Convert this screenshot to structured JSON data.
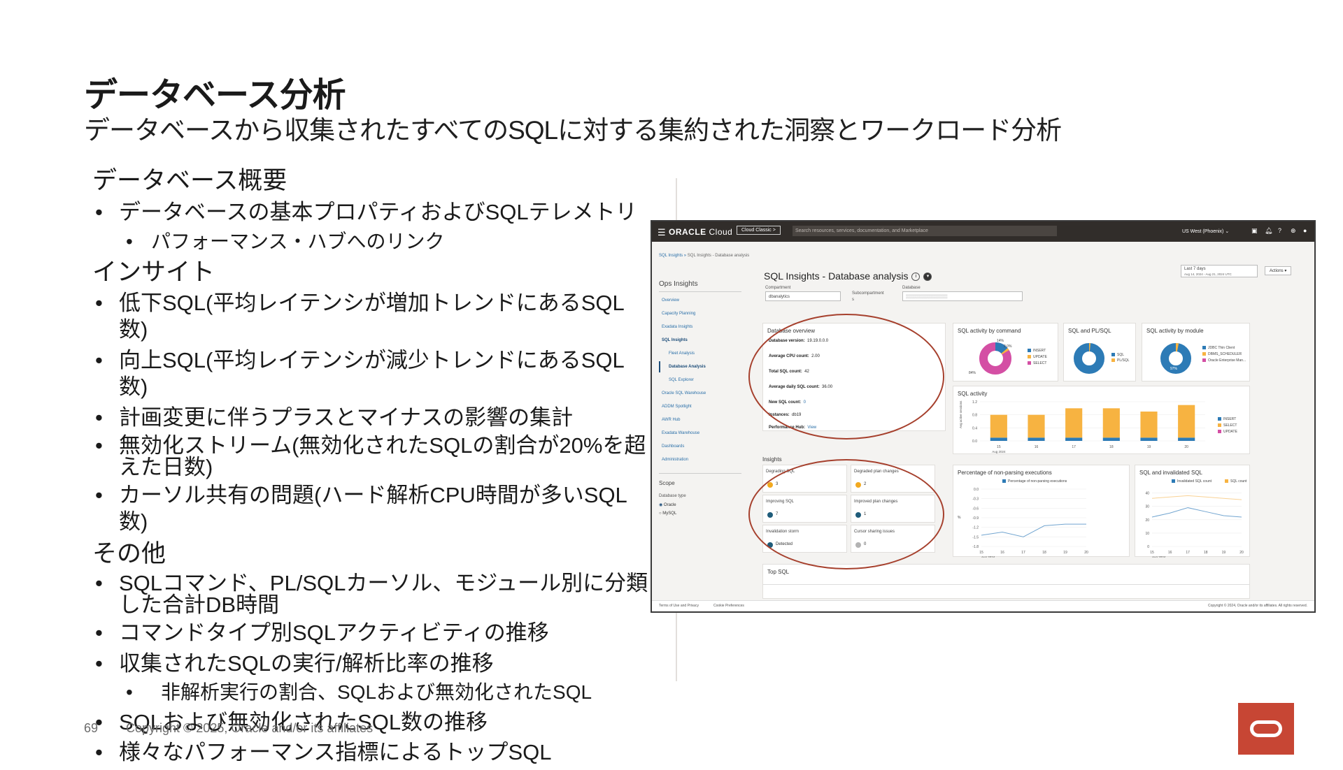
{
  "slide": {
    "title": "データベース分析",
    "subtitle": "データベースから収集されたすべてのSQLに対する集約された洞察とワークロード分析",
    "page_number": "69",
    "copyright": "Copyright © 2025, Oracle and/or its affiliates"
  },
  "outline": {
    "h1": "データベース概要",
    "i1": "データベースの基本プロパティおよびSQLテレメトリ",
    "i1a": "パフォーマンス・ハブへのリンク",
    "h2": "インサイト",
    "i2": "低下SQL(平均レイテンシが増加トレンドにあるSQL数)",
    "i3": "向上SQL(平均レイテンシが減少トレンドにあるSQL数)",
    "i4": "計画変更に伴うプラスとマイナスの影響の集計",
    "i5": "無効化ストリーム(無効化されたSQLの割合が20%を超えた日数)",
    "i6": "カーソル共有の問題(ハード解析CPU時間が多いSQL数)",
    "h3": "その他",
    "i7": "SQLコマンド、PL/SQLカーソル、モジュール別に分類した合計DB時間",
    "i8": "コマンドタイプ別SQLアクティビティの推移",
    "i9": "収集されたSQLの実行/解析比率の推移",
    "i9a": "非解析実行の割合、SQLおよび無効化されたSQL",
    "i10": "SQLおよび無効化されたSQL数の推移",
    "i11": "様々なパフォーマンス指標によるトップSQL"
  },
  "console": {
    "brand_a": "ORACLE",
    "brand_b": " Cloud",
    "classic": "Cloud Classic >",
    "search_placeholder": "Search resources, services, documentation, and Marketplace",
    "region": "US West (Phoenix) ⌄",
    "crumb_a": "SQL Insights »",
    "crumb_b": " SQL Insights - Database analysis",
    "nav_title": "Ops Insights",
    "nav": [
      "Overview",
      "Capacity Planning",
      "Exadata Insights",
      "SQL Insights",
      "Fleet Analysis",
      "Database Analysis",
      "SQL Explorer",
      "Oracle SQL Warehouse",
      "ADDM Spotlight",
      "AWR Hub",
      "Exadata Warehouse",
      "Dashboards",
      "Administration"
    ],
    "scope": "Scope",
    "db_type": "Database type",
    "db_oracle": "Oracle",
    "db_mysql": "MySQL",
    "page_title": "SQL Insights - Database analysis",
    "compartment_label": "Compartment",
    "compartment_value": "dbanalytics",
    "subcompartment_label": "Subcompartment",
    "subcompartment_value": "s",
    "database_label": "Database",
    "time_label": "Last 7 days",
    "time_range": "Aug 14, 2024 - Aug 21, 2024 UTC",
    "actions": "Actions ▾",
    "overview": {
      "title": "Database overview",
      "version_k": "Database version:",
      "version_v": "19.19.0.0.0",
      "cpu_k": "Average CPU count:",
      "cpu_v": "2.00",
      "total_k": "Total SQL count:",
      "total_v": "42",
      "daily_k": "Average daily SQL count:",
      "daily_v": "36.00",
      "new_k": "New SQL count:",
      "new_v": "0",
      "inst_k": "Instances:",
      "inst_v": "db19",
      "perf_k": "Performance Hub:",
      "perf_v": "View"
    },
    "cmd_card": {
      "title": "SQL activity by command",
      "l1": "INSERT",
      "l2": "UPDATE",
      "l3": "SELECT",
      "p1": "14%",
      "p2": "2.0%",
      "p3": "84%"
    },
    "plsql_card": {
      "title": "SQL and PL/SQL",
      "l1": "SQL",
      "l2": "PL/SQL"
    },
    "module_card": {
      "title": "SQL activity by module",
      "l1": "JDBC Thin Client",
      "l2": "DBMS_SCHEDULER",
      "l3": "Oracle Enterprise Man...",
      "p": "97%"
    },
    "activity": {
      "title": "SQL activity",
      "ylabel": "Avg active sessions",
      "l1": "INSERT",
      "l2": "SELECT",
      "l3": "UPDATE",
      "month": "Aug 2024"
    },
    "insights_title": "Insights",
    "insights": [
      {
        "t": "Degrading SQL",
        "n": "3"
      },
      {
        "t": "Degraded plan changes",
        "n": "2"
      },
      {
        "t": "Improving SQL",
        "n": "7"
      },
      {
        "t": "Improved plan changes",
        "n": "1"
      },
      {
        "t": "Invalidation storm",
        "n": "Detected"
      },
      {
        "t": "Cursor sharing issues",
        "n": "0"
      }
    ],
    "nonparse": {
      "title": "Percentage of non-parsing executions",
      "legend": "Percentage of non-parsing executions",
      "ylabel": "%",
      "month": "Aug 2024"
    },
    "invalid": {
      "title": "SQL and invalidated SQL",
      "l1": "Invalidated SQL count",
      "l2": "SQL count",
      "month": "Aug 2024"
    },
    "top_sql": "Top SQL",
    "footer_l1": "Terms of Use and Privacy",
    "footer_l2": "Cookie Preferences",
    "footer_r": "Copyright © 2024, Oracle and/or its affiliates. All rights reserved.",
    "colors": {
      "insert": "#2d7bb6",
      "update": "#d44fa4",
      "select": "#f7b341",
      "accent": "#a6402d"
    }
  },
  "chart_data": [
    {
      "type": "bar",
      "title": "SQL activity",
      "categories": [
        "15",
        "16",
        "17",
        "18",
        "19",
        "20"
      ],
      "series": [
        {
          "name": "INSERT",
          "values": [
            0.1,
            0.1,
            0.1,
            0.1,
            0.1,
            0.1
          ]
        },
        {
          "name": "SELECT",
          "values": [
            0.7,
            0.7,
            0.9,
            0.9,
            0.8,
            1.0
          ]
        }
      ],
      "yticks": [
        "1.2",
        "0.8",
        "0.4",
        "0.0"
      ],
      "ylim": [
        0,
        1.2
      ]
    },
    {
      "type": "line",
      "title": "Percentage of non-parsing executions",
      "x": [
        "15",
        "16",
        "17",
        "18",
        "19",
        "20"
      ],
      "series": [
        {
          "name": "Percentage of non-parsing executions",
          "values": [
            -1.45,
            -1.35,
            -1.5,
            -1.15,
            -1.1,
            -1.1
          ]
        }
      ],
      "yticks": [
        "0.0",
        "-0.3",
        "-0.6",
        "-0.9",
        "-1.2",
        "-1.5",
        "-1.8"
      ],
      "ylim": [
        -1.8,
        0
      ]
    },
    {
      "type": "line",
      "title": "SQL and invalidated SQL",
      "x": [
        "15",
        "16",
        "17",
        "18",
        "19",
        "20"
      ],
      "series": [
        {
          "name": "Invalidated SQL count",
          "values": [
            22,
            25,
            29,
            26,
            23,
            22
          ]
        },
        {
          "name": "SQL count",
          "values": [
            36,
            37,
            38,
            37,
            36,
            35
          ]
        }
      ],
      "yticks": [
        "40",
        "30",
        "20",
        "10",
        "0"
      ],
      "ylim": [
        0,
        45
      ]
    }
  ]
}
